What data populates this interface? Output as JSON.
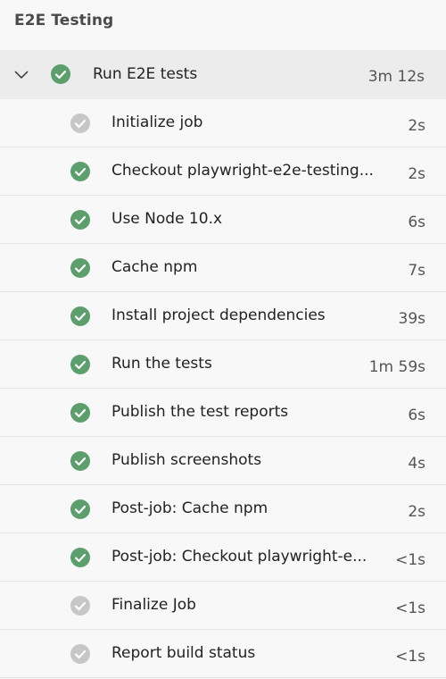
{
  "panel": {
    "title": "E2E Testing"
  },
  "colors": {
    "success": "#5c9e6c",
    "pending": "#c7c7c7"
  },
  "job": {
    "name": "Run E2E tests",
    "duration": "3m 12s",
    "status": "success",
    "expanded": true
  },
  "steps": [
    {
      "name": "Initialize job",
      "duration": "2s",
      "status": "pending"
    },
    {
      "name": "Checkout playwright-e2e-testing...",
      "duration": "2s",
      "status": "success"
    },
    {
      "name": "Use Node 10.x",
      "duration": "6s",
      "status": "success"
    },
    {
      "name": "Cache npm",
      "duration": "7s",
      "status": "success"
    },
    {
      "name": "Install project dependencies",
      "duration": "39s",
      "status": "success"
    },
    {
      "name": "Run the tests",
      "duration": "1m 59s",
      "status": "success"
    },
    {
      "name": "Publish the test reports",
      "duration": "6s",
      "status": "success"
    },
    {
      "name": "Publish screenshots",
      "duration": "4s",
      "status": "success"
    },
    {
      "name": "Post-job: Cache npm",
      "duration": "2s",
      "status": "success"
    },
    {
      "name": "Post-job: Checkout playwright-e...",
      "duration": "<1s",
      "status": "success"
    },
    {
      "name": "Finalize Job",
      "duration": "<1s",
      "status": "pending"
    },
    {
      "name": "Report build status",
      "duration": "<1s",
      "status": "pending"
    }
  ]
}
